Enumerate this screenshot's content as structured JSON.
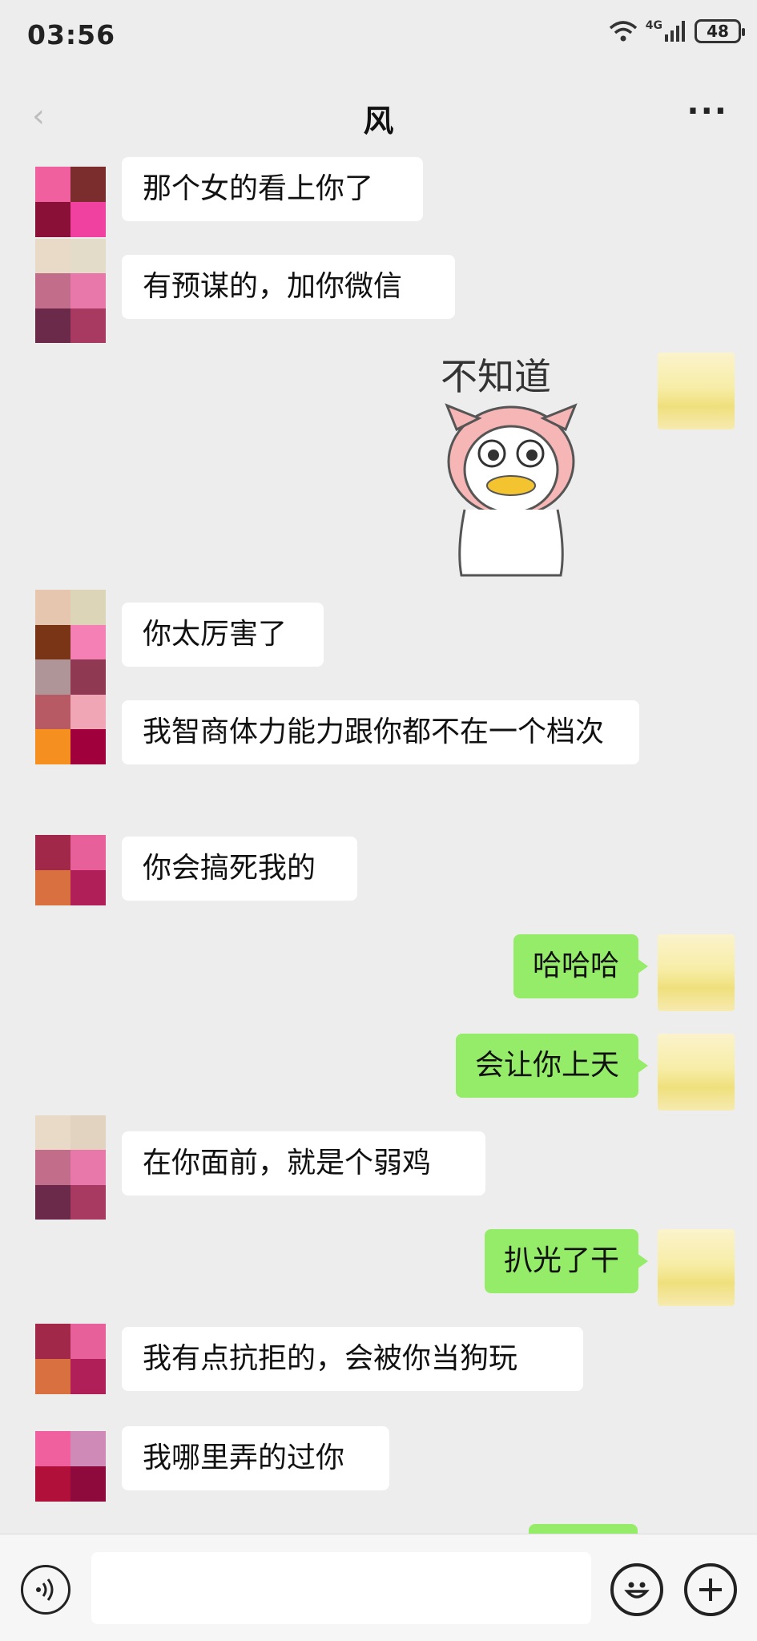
{
  "status_bar": {
    "time": "03:56",
    "network": "4G",
    "battery": "48"
  },
  "header": {
    "title": "风",
    "back": "‹",
    "more": "···"
  },
  "messages": [
    {
      "side": "left",
      "text": "那个女的看上你了"
    },
    {
      "side": "left",
      "text": "有预谋的，加你微信"
    },
    {
      "side": "right",
      "type": "sticker",
      "text": "不知道"
    },
    {
      "side": "left",
      "text": "你太厉害了"
    },
    {
      "side": "left",
      "text": "我智商体力能力跟你都不在一个档次"
    },
    {
      "side": "left",
      "text": "你会搞死我的"
    },
    {
      "side": "right",
      "text": "哈哈哈"
    },
    {
      "side": "right",
      "text": "会让你上天"
    },
    {
      "side": "left",
      "text": "在你面前，就是个弱鸡"
    },
    {
      "side": "right",
      "text": "扒光了干"
    },
    {
      "side": "left",
      "text": "我有点抗拒的，会被你当狗玩"
    },
    {
      "side": "left",
      "text": "我哪里弄的过你"
    }
  ],
  "input_bar": {
    "voice_icon": "voice-icon",
    "emoji_icon": "emoji-icon",
    "plus_icon": "plus-icon"
  },
  "colors": {
    "background": "#ededed",
    "bubble_self": "#95ec69",
    "bubble_other": "#ffffff"
  }
}
